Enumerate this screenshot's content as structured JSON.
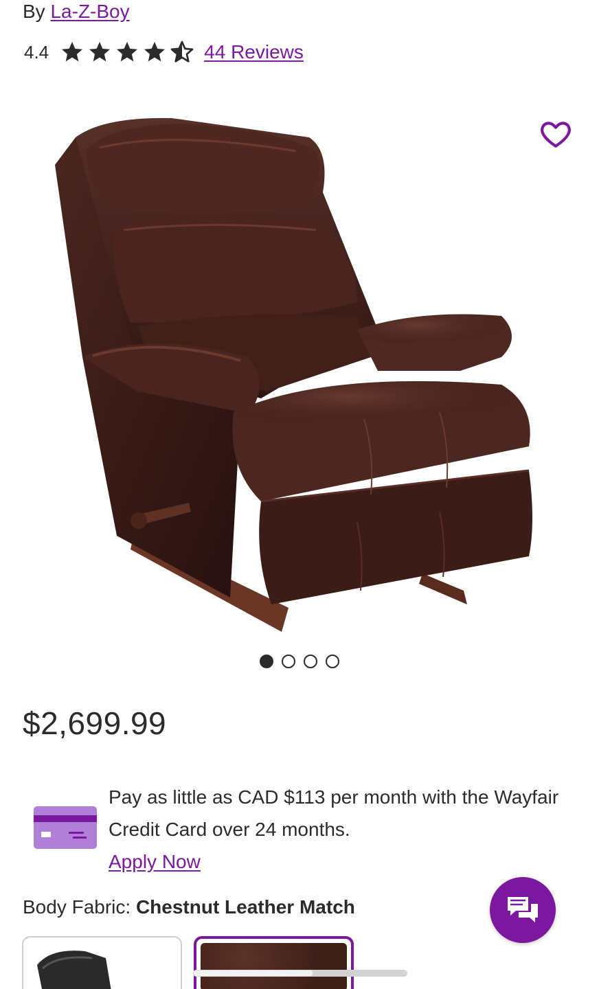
{
  "product": {
    "brand_prefix": "By",
    "brand_name": "La-Z-Boy",
    "rating": "4.4",
    "rating_value": 4.4,
    "rating_max": 5,
    "reviews_label": "44 Reviews",
    "price": "$2,699.99"
  },
  "gallery": {
    "image_count": 4,
    "active_index": 0
  },
  "credit": {
    "text": "Pay as little as CAD $113 per month with the Wayfair Credit Card over 24 months.",
    "apply_label": "Apply Now"
  },
  "fabric": {
    "label": "Body Fabric:",
    "value": "Chestnut Leather Match"
  },
  "icons": {
    "favorite": "heart-icon",
    "chat": "chat-icon",
    "card": "credit-card-icon",
    "star_full": "star-icon",
    "star_half": "star-half-icon"
  },
  "colors": {
    "accent": "#7b189f",
    "text": "#2b2b2b",
    "card_light": "#b07fd6",
    "leather": "#3a1b16"
  }
}
